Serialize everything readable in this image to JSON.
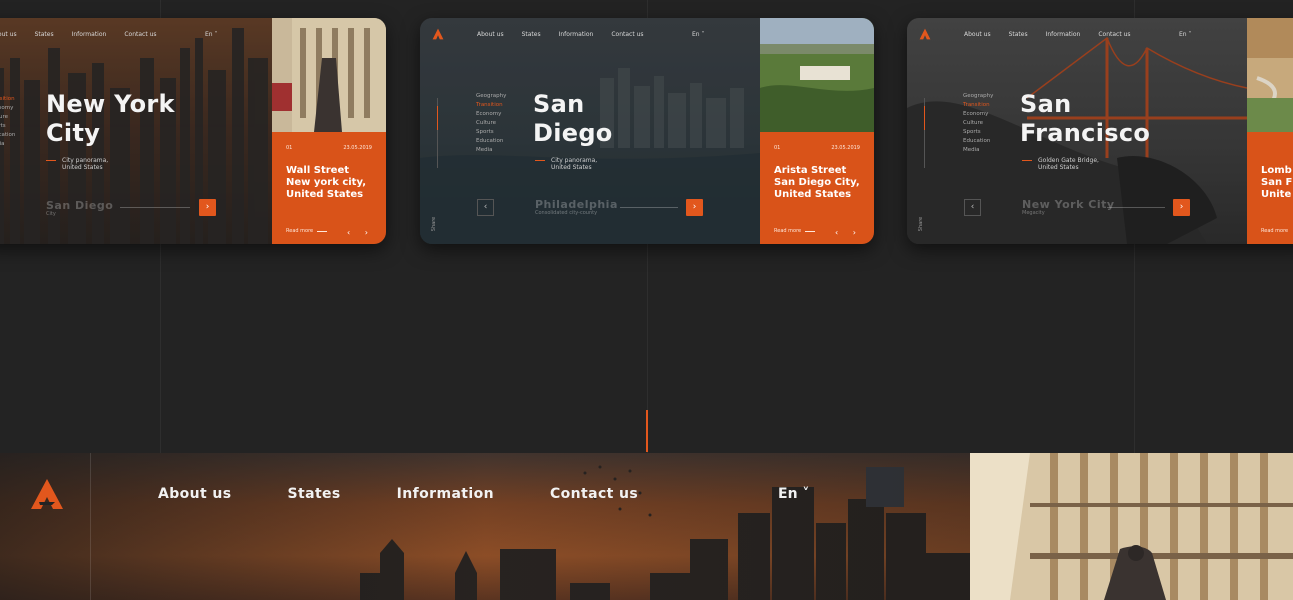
{
  "brand": {
    "accent": "#e2571d",
    "background": "#232323"
  },
  "nav": {
    "items": [
      "About us",
      "States",
      "Information",
      "Contact us"
    ],
    "language": "En",
    "language_arrow": "˅"
  },
  "side_menu": [
    "Geography",
    "Transition",
    "Economy",
    "Culture",
    "Sports",
    "Education",
    "Media"
  ],
  "share_label": "Share",
  "cards": [
    {
      "title_line1": "New York",
      "title_line2": "City",
      "subtitle_line1": "City panorama,",
      "subtitle_line2": "United States",
      "next_city": "San Diego",
      "next_city_sub": "City",
      "slide_number": "01",
      "date": "23.05.2019",
      "orange_line1": "Wall Street",
      "orange_line2": "New york city,",
      "orange_line3": "United States",
      "read_more": "Read more",
      "nav_arrows": "‹ ›",
      "next_arrow": "›"
    },
    {
      "title_line1": "San",
      "title_line2": "Diego",
      "subtitle_line1": "City panorama,",
      "subtitle_line2": "United States",
      "next_city": "Philadelphia",
      "next_city_sub": "Consolidated city-county",
      "slide_number": "01",
      "date": "23.05.2019",
      "orange_line1": "Arista Street",
      "orange_line2": "San Diego City,",
      "orange_line3": "United States",
      "read_more": "Read more",
      "nav_arrows": "‹ ›",
      "prev_arrow": "‹",
      "next_arrow": "›"
    },
    {
      "title_line1": "San",
      "title_line2": "Francisco",
      "subtitle_line1": "Golden Gate Bridge,",
      "subtitle_line2": "United States",
      "next_city": "New York City",
      "next_city_sub": "Megacity",
      "orange_line1": "Lomb",
      "orange_line2": "San F",
      "orange_line3": "Unite",
      "read_more": "Read more",
      "prev_arrow": "‹",
      "next_arrow": "›"
    }
  ]
}
